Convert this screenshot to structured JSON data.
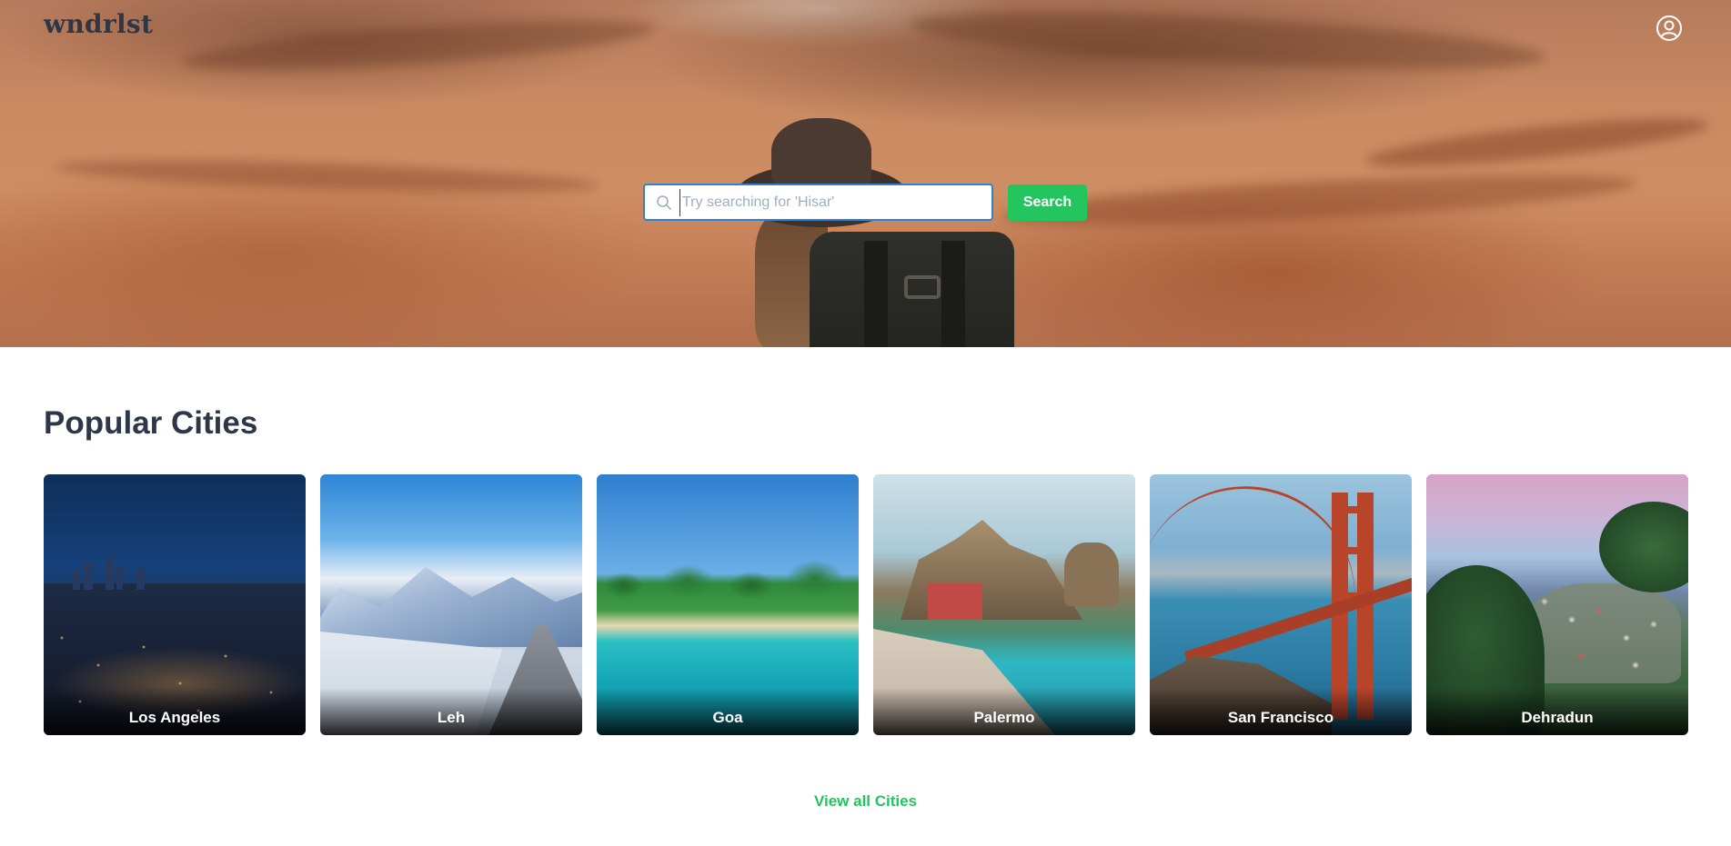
{
  "header": {
    "logo_text": "wndrlst",
    "profile_icon": "user-circle-icon"
  },
  "search": {
    "placeholder": "Try searching for 'Hisar'",
    "value": "",
    "button_label": "Search",
    "icon": "search-icon"
  },
  "popular": {
    "title": "Popular Cities",
    "cities": [
      {
        "name": "Los Angeles"
      },
      {
        "name": "Leh"
      },
      {
        "name": "Goa"
      },
      {
        "name": "Palermo"
      },
      {
        "name": "San Francisco"
      },
      {
        "name": "Dehradun"
      }
    ],
    "view_all_label": "View all Cities"
  },
  "colors": {
    "accent_green": "#22c55e",
    "text_dark": "#2d3748",
    "input_focus_border": "#3182ce"
  }
}
